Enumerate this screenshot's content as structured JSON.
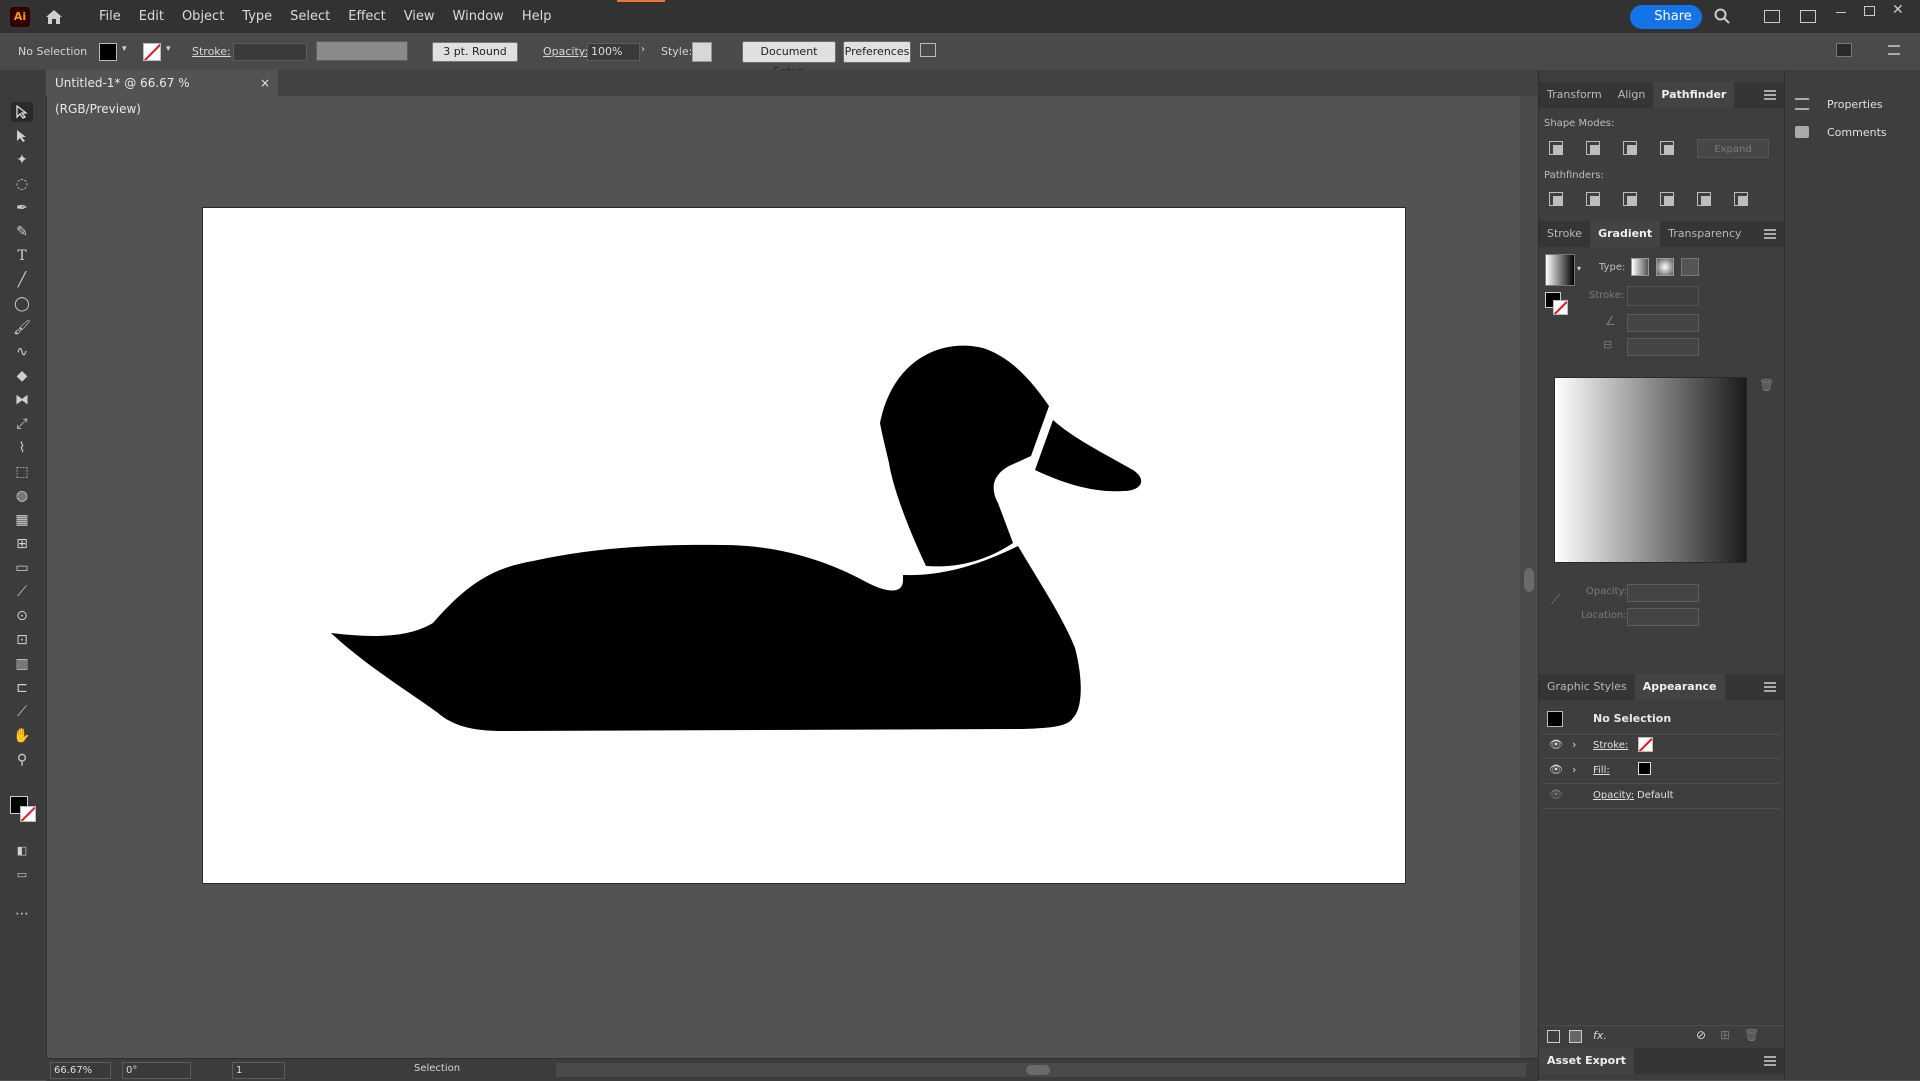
{
  "app": {
    "logo": "Ai",
    "home_icon": "home-icon"
  },
  "menu": [
    "File",
    "Edit",
    "Object",
    "Type",
    "Select",
    "Effect",
    "View",
    "Window",
    "Help"
  ],
  "share_label": "Share",
  "control": {
    "selection": "No Selection",
    "stroke_label": "Stroke:",
    "brush_label": "3 pt. Round",
    "opacity_label": "Opacity:",
    "opacity_value": "100%",
    "style_label": "Style:",
    "doc_setup": "Document Setup",
    "preferences": "Preferences"
  },
  "document": {
    "tab_title": "Untitled-1* @ 66.67 % (RGB/Preview)",
    "close": "×"
  },
  "status": {
    "zoom": "66.67%",
    "rotation": "0°",
    "artboard": "1",
    "tool": "Selection"
  },
  "panels": {
    "top_tabs": [
      "Transform",
      "Align",
      "Pathfinder"
    ],
    "top_active": "Pathfinder",
    "shape_modes": "Shape Modes:",
    "expand": "Expand",
    "pathfinders": "Pathfinders:",
    "mid_tabs": [
      "Stroke",
      "Gradient",
      "Transparency"
    ],
    "mid_active": "Gradient",
    "type_label": "Type:",
    "stroke_label": "Stroke:",
    "opacity_label": "Opacity:",
    "location_label": "Location:",
    "bottom_tabs": [
      "Graphic Styles",
      "Appearance"
    ],
    "bottom_active": "Appearance",
    "appearance_title": "No Selection",
    "appearance_rows": [
      {
        "label": "Stroke:"
      },
      {
        "label": "Fill:"
      },
      {
        "label": "Opacity:",
        "value": "Default"
      }
    ],
    "asset_export": "Asset Export"
  },
  "side": {
    "properties": "Properties",
    "comments": "Comments"
  },
  "colors": {
    "accent": "#1473e6",
    "none_slash": "#e0141e",
    "ai_orange": "#ff9a00"
  }
}
